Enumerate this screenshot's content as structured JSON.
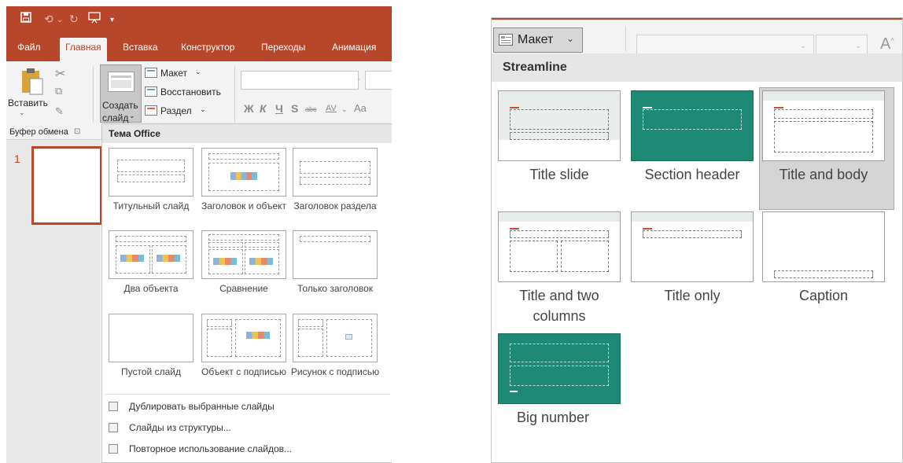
{
  "left": {
    "tabs": [
      "Файл",
      "Главная",
      "Вставка",
      "Конструктор",
      "Переходы",
      "Анимация"
    ],
    "ribbon": {
      "paste_label": "Вставить",
      "create_label_1": "Создать",
      "create_label_2": "слайд",
      "layout_label": "Макет",
      "reset_label": "Восстановить",
      "section_label": "Раздел",
      "group_clipboard": "Буфер обмена",
      "font_buttons": [
        "Ж",
        "К",
        "Ч",
        "S",
        "abc",
        "AV",
        "Aa"
      ]
    },
    "thumbnail_number": "1",
    "dropdown": {
      "header": "Тема Office",
      "layouts": [
        {
          "label": "Титульный слайд"
        },
        {
          "label": "Заголовок и объект"
        },
        {
          "label": "Заголовок раздела"
        },
        {
          "label": "Два объекта"
        },
        {
          "label": "Сравнение"
        },
        {
          "label": "Только заголовок"
        },
        {
          "label": "Пустой слайд"
        },
        {
          "label": "Объект с подписью"
        },
        {
          "label": "Рисунок с подписью"
        }
      ],
      "menu": [
        {
          "label": "Дублировать выбранные слайды"
        },
        {
          "label": "Слайды из структуры..."
        },
        {
          "label": "Повторное использование слайдов..."
        }
      ]
    }
  },
  "right": {
    "maket_label": "Макет",
    "dropdown": {
      "header": "Streamline",
      "layouts": [
        {
          "label": "Title slide",
          "selected": false
        },
        {
          "label": "Section header",
          "selected": false
        },
        {
          "label": "Title and body",
          "selected": true
        },
        {
          "label": "Title and two columns",
          "selected": false
        },
        {
          "label": "Title only",
          "selected": false
        },
        {
          "label": "Caption",
          "selected": false
        },
        {
          "label": "Big number",
          "selected": false
        }
      ]
    }
  },
  "colors": {
    "ppt_accent": "#b7472a",
    "teal": "#1e8a76"
  }
}
